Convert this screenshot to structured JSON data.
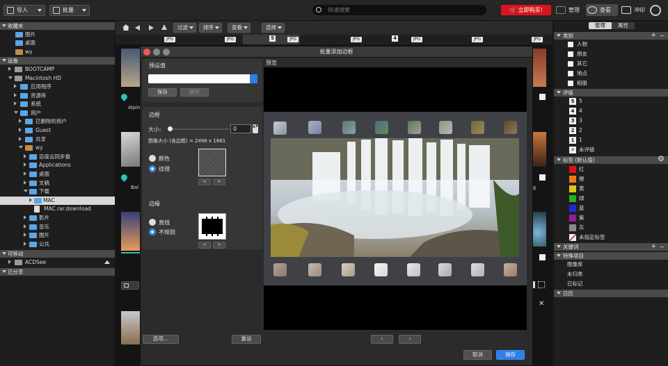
{
  "topbar": {
    "import_label": "导入",
    "batch_label": "批量",
    "search_placeholder": "快速搜索",
    "buy_label": "立即购买!",
    "modes": [
      "管理",
      "查看",
      "冲印"
    ]
  },
  "left": {
    "favorites": {
      "header": "收藏夹",
      "items": [
        "图片",
        "桌面",
        "wy"
      ]
    },
    "devices": {
      "header": "设备",
      "items": [
        "BOOTCAMP",
        "Macintosh HD",
        "应用程序",
        "资源库",
        "系统",
        "用户",
        "已删除的用户",
        "Guest",
        "共享",
        "wy",
        "百度云同步盘",
        "Applications",
        "桌面",
        "文稿",
        "下载",
        "MAC",
        "MAC.rar.download",
        "影片",
        "音乐",
        "图片",
        "公共"
      ]
    },
    "removable": {
      "header": "可移动",
      "items": [
        "ACDSee"
      ]
    },
    "shared": {
      "header": "已分享"
    }
  },
  "center": {
    "toolbar": {
      "filter": "过滤",
      "sort": "排序",
      "view": "查看",
      "select": "选择"
    },
    "jpg_tag": "JPG",
    "badges": [
      "5",
      "4"
    ],
    "thumb_labels": [
      "Alpin",
      "Bal",
      "g",
      ".jpg"
    ]
  },
  "dialog": {
    "title": "批量添加边框",
    "preset": {
      "title": "预设值",
      "save": "保存",
      "delete": "删除"
    },
    "border": {
      "title": "边框",
      "size_label": "大小:",
      "size_value": "0",
      "size_level": 0,
      "image_size_label": "图像大小 (含边框) =",
      "image_size_value": "2496 x 1661",
      "color_label": "颜色",
      "texture_label": "纹理"
    },
    "edge": {
      "title": "边缘",
      "straight_label": "直线",
      "irregular_label": "不规则"
    },
    "preview_label": "预览",
    "options_button": "选项...",
    "reset_button": "重设",
    "cancel_button": "取消",
    "save_button": "保存"
  },
  "right": {
    "tabs": [
      "整理",
      "属性"
    ],
    "category": {
      "header": "类别",
      "items": [
        "人物",
        "朋友",
        "其它",
        "地点",
        "相册"
      ]
    },
    "rating": {
      "header": "评级",
      "items": [
        {
          "num": "5",
          "label": "5"
        },
        {
          "num": "4",
          "label": "4"
        },
        {
          "num": "3",
          "label": "3"
        },
        {
          "num": "2",
          "label": "2"
        },
        {
          "num": "1",
          "label": "1"
        }
      ],
      "unrated": "未评级"
    },
    "labels": {
      "header": "标签 (默认值)",
      "items": [
        {
          "name": "红",
          "color": "#e01010"
        },
        {
          "name": "橙",
          "color": "#ef7b12"
        },
        {
          "name": "黄",
          "color": "#dcc813"
        },
        {
          "name": "绿",
          "color": "#1fb21f"
        },
        {
          "name": "蓝",
          "color": "#1c2bd9"
        },
        {
          "name": "紫",
          "color": "#8e1d9c"
        },
        {
          "name": "灰",
          "color": "#8a8a8a"
        }
      ],
      "unassigned": "未指定标签"
    },
    "keywords": {
      "header": "关键词"
    },
    "special": {
      "header": "特殊项目",
      "items": [
        "图像库",
        "未归类",
        "已标记"
      ]
    },
    "calendar": {
      "header": "日历"
    }
  }
}
